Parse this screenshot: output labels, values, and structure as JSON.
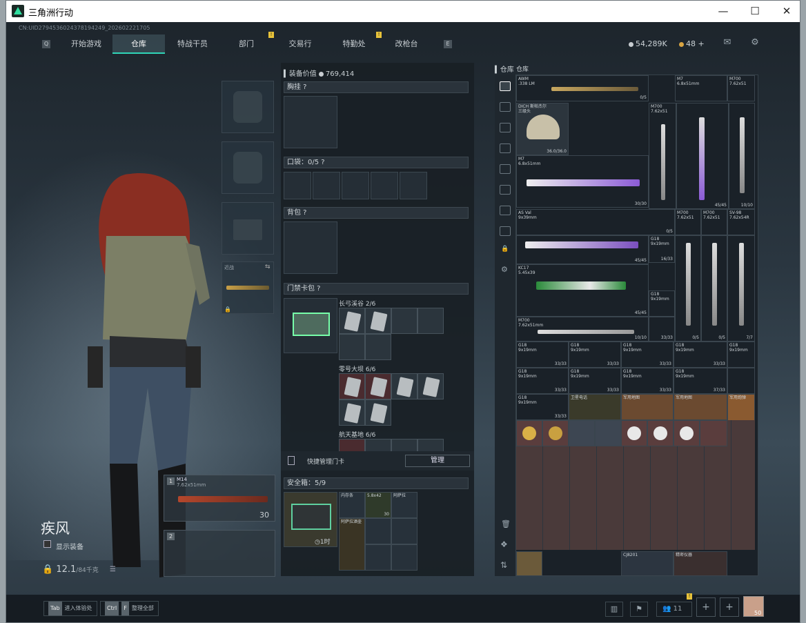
{
  "window": {
    "title": "三角洲行动",
    "min": "—",
    "max": "☐",
    "close": "✕"
  },
  "uid": "CN:UID2794536024378194249_202602221705",
  "nav": {
    "left_key": "Q",
    "right_key": "E",
    "tabs": [
      {
        "label": "开始游戏"
      },
      {
        "label": "仓库"
      },
      {
        "label": "特战干员"
      },
      {
        "label": "部门"
      },
      {
        "label": "交易行"
      },
      {
        "label": "特勤处"
      },
      {
        "label": "改枪台"
      }
    ],
    "badge": "!"
  },
  "currency": {
    "coins": "54,289K",
    "tokens": "48 +"
  },
  "icons": {
    "mail": "mail-icon",
    "settings": "gear-icon"
  },
  "character": {
    "name": "疾风",
    "show_gear": "显示装备",
    "weight": "12.1",
    "weight_max": "/84千克"
  },
  "slots": {
    "sidearm_label": "近战",
    "primary_name": "M14",
    "primary_sub": "7.62x51mm",
    "primary_ammo": "30",
    "slot1": "1",
    "slot2": "2"
  },
  "middle": {
    "value_label": "装备价值",
    "value": "769,414",
    "chest": "胸挂",
    "pocket": "口袋：",
    "pocket_count": "0",
    "pocket_max": "/5",
    "backpack": "背包",
    "keybag": "门禁卡包",
    "key_sections": [
      {
        "name": "长弓溪谷",
        "count": "2/6"
      },
      {
        "name": "零号大坝",
        "count": "6/6"
      },
      {
        "name": "航天基地",
        "count": "6/6"
      }
    ],
    "quick_manage": "快捷管理门卡",
    "manage_btn": "管理",
    "safebox": "安全箱：",
    "safebox_count": "5",
    "safebox_max": "/9",
    "safebox_time": "1时",
    "safebox_items": [
      "内存条",
      "5.8x42",
      "阿萨拉",
      "阿萨拉酒壶"
    ],
    "safebox_ammo": "30"
  },
  "stash": {
    "title": "仓库",
    "sub": "仓库",
    "guns": [
      {
        "name": "AWM",
        "sub": ".338 LM",
        "count": "0/5"
      },
      {
        "name": "M7",
        "sub": "6.8x51mm"
      },
      {
        "name": "M700",
        "sub": "7.62x51"
      },
      {
        "name": "DICH 斯帕杰尔",
        "sub": "三级头",
        "count": "36.0/36.0"
      },
      {
        "name": "M700",
        "sub": "7.62x51"
      },
      {
        "name": "M7",
        "sub": "6.8x51mm",
        "count": "30/30"
      },
      {
        "name": "AS Val",
        "sub": "9x39mm",
        "count": "0/5"
      },
      {
        "name": "M700",
        "sub": "7.62x51"
      },
      {
        "name": "M700",
        "sub": "7.62x51"
      },
      {
        "name": "SV-98",
        "sub": "7.62x54R"
      },
      {
        "name": "KC17",
        "sub": "5.45x39",
        "count": "45/45"
      },
      {
        "name": "M700",
        "sub": "7.62x51mm",
        "count": "10/10"
      }
    ],
    "counts": {
      "c1": "45/45",
      "c2": "10/10",
      "c3": "45/45",
      "c4": "33/33",
      "c5": "0/5",
      "c6": "0/5",
      "c7": "7/7",
      "c8": "16/33",
      "c9": "33/33",
      "c10": "37/33"
    },
    "g18": "G18",
    "g18sub": "9x19mm",
    "g18count": "33/33",
    "misc": [
      "卫星电话",
      "紫外线",
      "军用地图",
      "军用地图",
      "军用炮弹"
    ],
    "bottom": [
      "CJ8201",
      "精密仪器"
    ]
  },
  "bottom": {
    "key1": "Tab",
    "key1_label": "进入体验处",
    "key2": "Ctrl",
    "key2b": "F",
    "key2_label": "整理全部",
    "friends": "11",
    "level": "50"
  }
}
